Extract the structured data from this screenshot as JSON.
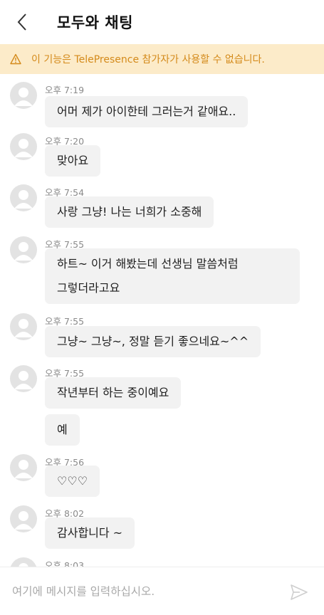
{
  "header": {
    "title": "모두와 채팅",
    "back_icon": "chevron-left-icon"
  },
  "warning": {
    "icon": "warning-triangle-icon",
    "text": "이 기능은 TelePresence 참가자가 사용할 수 없습니다.",
    "color": "#d48a1a",
    "background": "#fcebc9"
  },
  "messages": [
    {
      "time": "오후 7:19",
      "text": "어머  제가  아이한테 그러는거 같애요.."
    },
    {
      "time": "오후 7:20",
      "text": "맞아요"
    },
    {
      "time": "오후 7:54",
      "text": "사랑 그냥! 나는 너희가 소중해"
    },
    {
      "time": "오후 7:55",
      "lines": [
        "하트~ 이거 해봤는데 선생님 말씀처럼",
        "그렇더라고요"
      ]
    },
    {
      "time": "오후 7:55",
      "text": "그냥~ 그냥~, 정말 듣기 좋으네요~^^"
    },
    {
      "time": "오후 7:55",
      "text": "작년부터 하는 중이예요",
      "followup": "예"
    },
    {
      "time": "오후 7:56",
      "text": "♡♡♡"
    },
    {
      "time": "오후 8:02",
      "text": "감사합니다 ~"
    },
    {
      "time": "오후 8:03"
    }
  ],
  "composer": {
    "placeholder": "여기에 메시지를 입력하십시오.",
    "send_icon": "send-icon"
  }
}
